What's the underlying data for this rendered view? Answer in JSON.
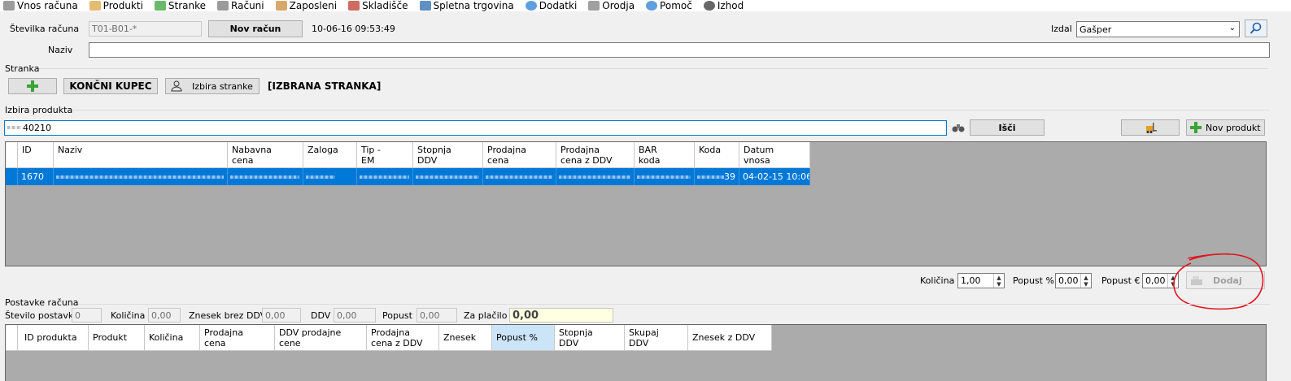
{
  "menu": [
    {
      "label": "Vnos računa",
      "icon": "document-icon",
      "color": "#7a7a7a"
    },
    {
      "label": "Produkti",
      "icon": "box-icon",
      "color": "#d9a441"
    },
    {
      "label": "Stranke",
      "icon": "customer-card-icon",
      "color": "#3aa33a"
    },
    {
      "label": "Računi",
      "icon": "invoice-icon",
      "color": "#7a7a7a"
    },
    {
      "label": "Zaposleni",
      "icon": "employees-icon",
      "color": "#c98b3b"
    },
    {
      "label": "Skladišče",
      "icon": "warehouse-list-icon",
      "color": "#c0392b"
    },
    {
      "label": "Spletna trgovina",
      "icon": "shopping-cart-icon",
      "color": "#2b6cb0"
    },
    {
      "label": "Dodatki",
      "icon": "plus-cloud-icon",
      "color": "#2a7fd4"
    },
    {
      "label": "Orodja",
      "icon": "tools-icon",
      "color": "#808080"
    },
    {
      "label": "Pomoč",
      "icon": "info-icon",
      "color": "#2a7fd4"
    },
    {
      "label": "Izhod",
      "icon": "power-icon",
      "color": "#333333"
    }
  ],
  "header": {
    "invoice_number_label": "Številka računa",
    "invoice_number_value": "T01-B01-*",
    "new_invoice_button": "Nov račun",
    "timestamp": "10-06-16 09:53:49",
    "issued_by_label": "Izdal",
    "issued_by_value": "Gašper",
    "name_label": "Naziv",
    "name_value": ""
  },
  "customer": {
    "group_label": "Stranka",
    "end_customer_button": "KONČNI KUPEC",
    "select_customer_button": "Izbira stranke",
    "selected_customer": "[IZBRANA STRANKA]"
  },
  "product_search": {
    "group_label": "Izbira produkta",
    "search_value": "40210",
    "search_button": "Išči",
    "new_product_button": "Nov produkt",
    "columns": [
      "ID",
      "Naziv",
      "Nabavna\ncena",
      "Zaloga",
      "Tip -\nEM",
      "Stopnja\nDDV",
      "Prodajna\ncena",
      "Prodajna\ncena z DDV",
      "BAR\nkoda",
      "Koda",
      "Datum\nvnosa"
    ],
    "row": {
      "id": "1670",
      "code_suffix": "39",
      "date": "04-02-15 10:06"
    }
  },
  "add_controls": {
    "quantity_label": "Količina",
    "quantity_value": "1,00",
    "discount_pct_label": "Popust %",
    "discount_pct_value": "0,00",
    "discount_eur_label": "Popust €",
    "discount_eur_value": "0,00",
    "add_button": "Dodaj"
  },
  "items": {
    "group_label": "Postavke računa",
    "count_label": "Število postavk",
    "count_value": "0",
    "quantity_label": "Količina",
    "quantity_value": "0,00",
    "net_label": "Znesek brez DDV",
    "net_value": "0,00",
    "vat_label": "DDV",
    "vat_value": "0,00",
    "discount_label": "Popust",
    "discount_value": "0,00",
    "to_pay_label": "Za plačilo",
    "to_pay_value": "0,00",
    "columns": [
      "ID produkta",
      "Produkt",
      "Količina",
      "Prodajna\ncena",
      "DDV prodajne\ncene",
      "Prodajna\ncena z DDV",
      "Znesek",
      "Popust %",
      "Stopnja\nDDV",
      "Skupaj\nDDV",
      "Znesek z DDV"
    ]
  },
  "colors": {
    "selection": "#0078d7",
    "annotation": "#e0141e",
    "grid_bg": "#ababab",
    "total_bg": "#ffffe1"
  }
}
